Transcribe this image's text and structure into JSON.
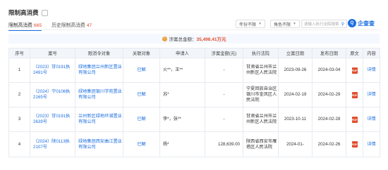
{
  "header": {
    "title": "限制高消费",
    "tab_current_label": "限制高消费",
    "tab_current_count": "665",
    "tab_history_label": "历史限制高消费",
    "tab_history_count": "47",
    "year_filter": "年份不限",
    "role_filter": "角色不限",
    "search_placeholder": "请输入执行法院搜索",
    "brand": "企查查",
    "brand_logo": "Q"
  },
  "summary": {
    "label": "涉案总金额：",
    "amount": "35,498.41万元"
  },
  "table": {
    "headers": [
      "序号",
      "案号",
      "限消令对象",
      "关联对象",
      "申请人",
      "涉案金额(元)",
      "执行法院",
      "立案日期",
      "发布日期",
      "原文",
      "内容"
    ],
    "rows": [
      {
        "no": "1",
        "case_no": "（2023）甘0191执2491号",
        "target": "绿地集团兰州新区置业有限公司",
        "relation": "已解",
        "applicant": "火**，王**",
        "amount": "-",
        "court": "甘肃省兰州市兰州新区人民法院",
        "filed": "2023-09-26",
        "published": "2024-03-04",
        "detail": "详情"
      },
      {
        "no": "2",
        "case_no": "（2024）宁0106执2165号",
        "target": "绿地集团银川学苑置业有限公司",
        "relation": "已解",
        "applicant": "苏*",
        "amount": "-",
        "court": "宁夏回族自治区银川市金凤区人民法院",
        "filed": "2024-02-19",
        "published": "2024-02-29",
        "detail": "详情"
      },
      {
        "no": "3",
        "case_no": "（2023）甘0191执2639号",
        "target": "兰州新区绿地环湖置业有限公司",
        "relation": "已解",
        "applicant": "李*，张**",
        "amount": "-",
        "court": "甘肃省兰州市兰州新区人民法院",
        "filed": "2023-10-11",
        "published": "2024-02-28",
        "detail": "详情"
      },
      {
        "no": "4",
        "case_no": "（2024）陕0113执2107号",
        "target": "绿地集团西安曲江置业有限公司",
        "relation": "已解",
        "applicant": "杨*",
        "amount": "128,639.00",
        "court": "陕西省西安市雁塔区人民法院",
        "filed": "2024-01-",
        "published": "2024-02-26",
        "detail": "详情"
      }
    ]
  },
  "icons": {
    "pdf": "pdf-icon",
    "search": "search-icon"
  },
  "colors": {
    "accent": "#1d6fe0",
    "highlight": "#e0502f",
    "pdf": "#e0502f"
  }
}
